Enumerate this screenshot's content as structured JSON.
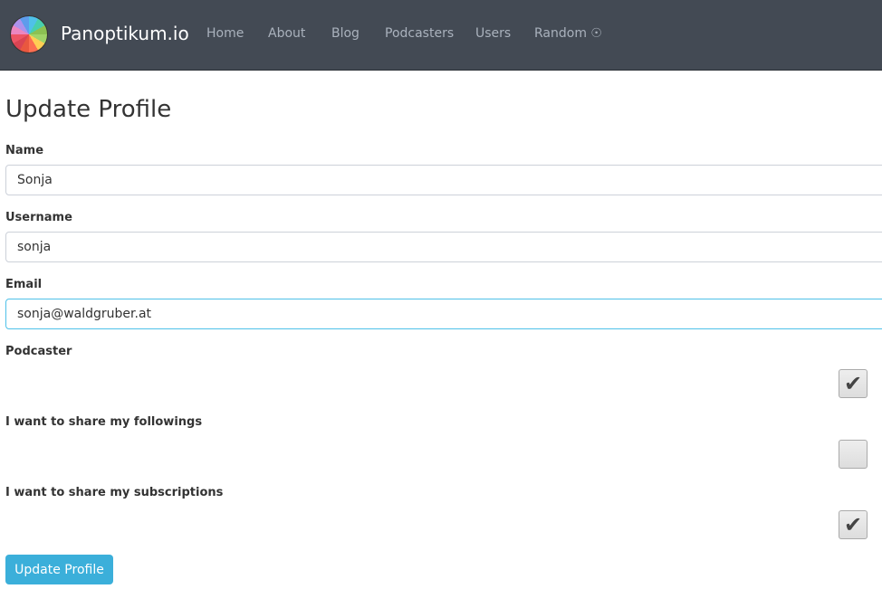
{
  "nav": {
    "brand": "Panoptikum.io",
    "items": [
      "Home",
      "About",
      "Blog",
      "Podcasters",
      "Users",
      "Random"
    ]
  },
  "page": {
    "title": "Update Profile"
  },
  "form": {
    "name": {
      "label": "Name",
      "value": "Sonja"
    },
    "username": {
      "label": "Username",
      "value": "sonja"
    },
    "email": {
      "label": "Email",
      "value": "sonja@waldgruber.at"
    },
    "podcaster": {
      "label": "Podcaster",
      "checked": true
    },
    "share_followings": {
      "label": "I want to share my followings",
      "checked": false
    },
    "share_subscriptions": {
      "label": "I want to share my subscriptions",
      "checked": true
    },
    "submit": "Update Profile"
  },
  "colors": {
    "navbar": "#434a54",
    "accent": "#3bafda"
  }
}
